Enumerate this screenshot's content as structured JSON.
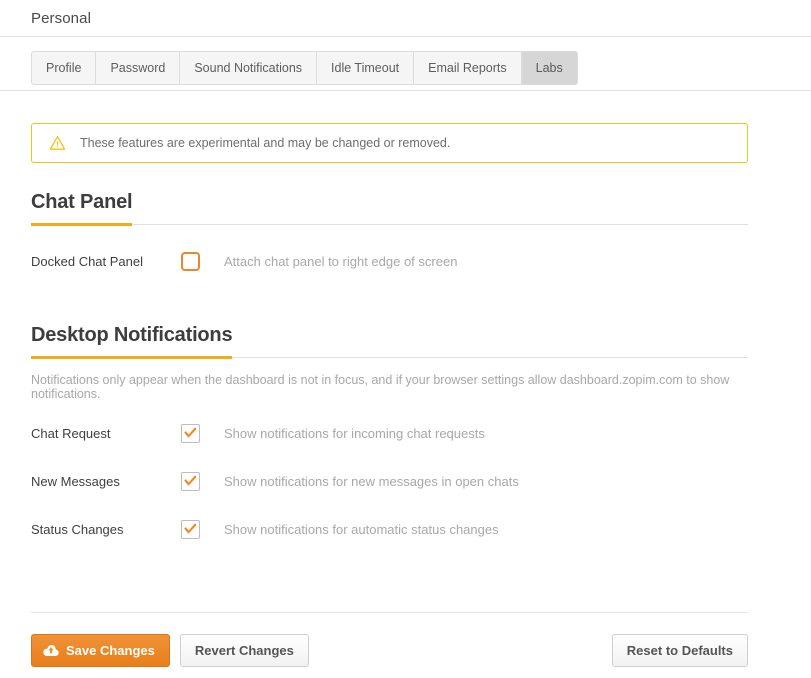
{
  "header": {
    "title": "Personal"
  },
  "tabs": [
    {
      "label": "Profile",
      "name": "tab-profile",
      "active": false
    },
    {
      "label": "Password",
      "name": "tab-password",
      "active": false
    },
    {
      "label": "Sound Notifications",
      "name": "tab-sound-notifications",
      "active": false
    },
    {
      "label": "Idle Timeout",
      "name": "tab-idle-timeout",
      "active": false
    },
    {
      "label": "Email Reports",
      "name": "tab-email-reports",
      "active": false
    },
    {
      "label": "Labs",
      "name": "tab-labs",
      "active": true
    }
  ],
  "warning": {
    "icon": "warning-triangle-icon",
    "text": "These features are experimental and may be changed or removed."
  },
  "chat_panel": {
    "title": "Chat Panel",
    "rows": [
      {
        "label": "Docked Chat Panel",
        "description": "Attach chat panel to right edge of screen",
        "checked": false
      }
    ]
  },
  "desktop_notifications": {
    "title": "Desktop Notifications",
    "helper": "Notifications only appear when the dashboard is not in focus, and if your browser settings allow dashboard.zopim.com to show notifications.",
    "rows": [
      {
        "label": "Chat Request",
        "description": "Show notifications for incoming chat requests",
        "checked": true
      },
      {
        "label": "New Messages",
        "description": "Show notifications for new messages in open chats",
        "checked": true
      },
      {
        "label": "Status Changes",
        "description": "Show notifications for automatic status changes",
        "checked": true
      }
    ]
  },
  "footer": {
    "save_label": "Save Changes",
    "save_icon": "cloud-upload-icon",
    "revert_label": "Revert Changes",
    "reset_label": "Reset to Defaults"
  },
  "colors": {
    "accent_orange": "#f0ad18",
    "button_orange": "#ec8a2d",
    "checkbox_orange": "#e8872b",
    "warning_border": "#f0c419",
    "text_dark": "#3d3d3d",
    "text_muted": "#a8a8a8"
  }
}
